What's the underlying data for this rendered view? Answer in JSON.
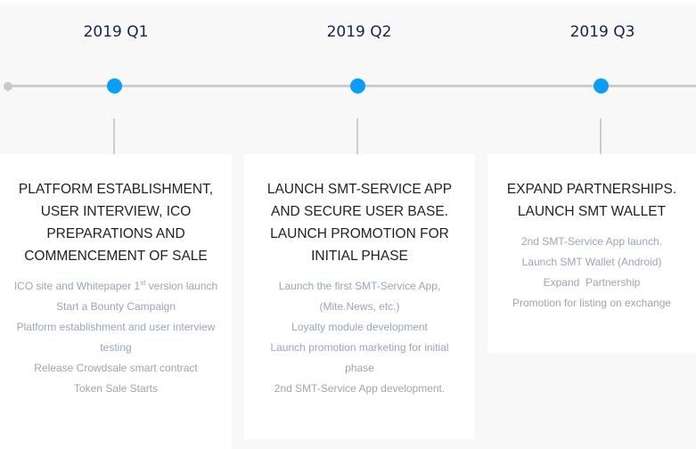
{
  "colors": {
    "accent": "#0a9dfa",
    "line": "#cccccc",
    "title": "#15264a",
    "item": "#9aa6b6"
  },
  "stages": [
    {
      "quarter": "2019 Q1",
      "title": "PLATFORM ESTABLISHMENT, USER INTERVIEW, ICO PREPARATIONS AND COMMENCEMENT OF SALE",
      "item0_pre": "ICO site and Whitepaper 1",
      "item0_sup": "st",
      "item0_post": " version launch",
      "items": [
        "Start a Bounty Campaign",
        "Platform establishment and user interview testing",
        "Release Crowdsale smart contract",
        "Token Sale Starts"
      ]
    },
    {
      "quarter": "2019 Q2",
      "title": "LAUNCH SMT-SERVICE APP AND SECURE USER BASE. LAUNCH PROMOTION FOR INITIAL PHASE",
      "items": [
        "Launch the first SMT-Service App, (Mite.News, etc.)",
        "Loyalty module development",
        "Launch promotion marketing for initial phase",
        "2nd SMT-Service App development."
      ]
    },
    {
      "quarter": "2019 Q3",
      "title": "EXPAND PARTNERSHIPS. LAUNCH SMT WALLET",
      "items": [
        "2nd SMT-Service App launch.",
        "Launch SMT Wallet (Android)",
        "Expand  Partnership",
        "Promotion for listing on exchange"
      ]
    }
  ]
}
